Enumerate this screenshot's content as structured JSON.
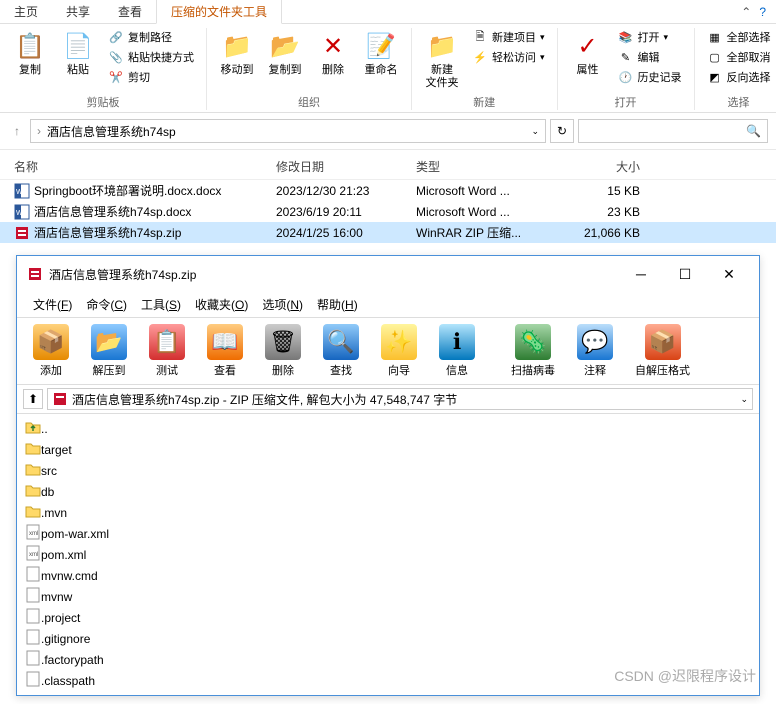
{
  "explorer": {
    "tabs": [
      "主页",
      "共享",
      "查看",
      "压缩的文件夹工具"
    ],
    "active_tab": 3,
    "ribbon": {
      "clipboard": {
        "copy": "复制",
        "paste": "粘贴",
        "copy_path": "复制路径",
        "paste_shortcut": "粘贴快捷方式",
        "cut": "剪切",
        "label": "剪贴板"
      },
      "organize": {
        "move_to": "移动到",
        "copy_to": "复制到",
        "delete": "删除",
        "rename": "重命名",
        "label": "组织"
      },
      "new": {
        "new_folder": "新建\n文件夹",
        "new_item": "新建项目",
        "easy_access": "轻松访问",
        "label": "新建"
      },
      "open": {
        "properties": "属性",
        "open": "打开",
        "edit": "编辑",
        "history": "历史记录",
        "label": "打开"
      },
      "select": {
        "select_all": "全部选择",
        "select_none": "全部取消",
        "invert": "反向选择",
        "label": "选择"
      }
    },
    "breadcrumb": {
      "folder": "酒店信息管理系统h74sp"
    },
    "columns": {
      "name": "名称",
      "date": "修改日期",
      "type": "类型",
      "size": "大小"
    },
    "files": [
      {
        "icon": "docx",
        "name": "Springboot环境部署说明.docx.docx",
        "date": "2023/12/30 21:23",
        "type": "Microsoft Word ...",
        "size": "15 KB"
      },
      {
        "icon": "docx",
        "name": "酒店信息管理系统h74sp.docx",
        "date": "2023/6/19 20:11",
        "type": "Microsoft Word ...",
        "size": "23 KB"
      },
      {
        "icon": "zip",
        "name": "酒店信息管理系统h74sp.zip",
        "date": "2024/1/25 16:00",
        "type": "WinRAR ZIP 压缩...",
        "size": "21,066 KB",
        "selected": true
      }
    ]
  },
  "winrar": {
    "title": "酒店信息管理系统h74sp.zip",
    "menu": [
      {
        "label": "文件",
        "key": "F"
      },
      {
        "label": "命令",
        "key": "C"
      },
      {
        "label": "工具",
        "key": "S"
      },
      {
        "label": "收藏夹",
        "key": "O"
      },
      {
        "label": "选项",
        "key": "N"
      },
      {
        "label": "帮助",
        "key": "H"
      }
    ],
    "toolbar": {
      "add": "添加",
      "extract": "解压到",
      "test": "测试",
      "view": "查看",
      "delete": "删除",
      "find": "查找",
      "wizard": "向导",
      "info": "信息",
      "scan": "扫描病毒",
      "comment": "注释",
      "sfx": "自解压格式"
    },
    "address": "酒店信息管理系统h74sp.zip - ZIP 压缩文件, 解包大小为 47,548,747 字节",
    "files": [
      {
        "icon": "up",
        "name": ".."
      },
      {
        "icon": "folder",
        "name": "target"
      },
      {
        "icon": "folder",
        "name": "src"
      },
      {
        "icon": "folder",
        "name": "db"
      },
      {
        "icon": "folder",
        "name": ".mvn"
      },
      {
        "icon": "xml",
        "name": "pom-war.xml"
      },
      {
        "icon": "xml",
        "name": "pom.xml"
      },
      {
        "icon": "file",
        "name": "mvnw.cmd"
      },
      {
        "icon": "file",
        "name": "mvnw"
      },
      {
        "icon": "file",
        "name": ".project"
      },
      {
        "icon": "file",
        "name": ".gitignore"
      },
      {
        "icon": "file",
        "name": ".factorypath"
      },
      {
        "icon": "file",
        "name": ".classpath"
      }
    ]
  },
  "watermark": "CSDN @迟限程序设计"
}
